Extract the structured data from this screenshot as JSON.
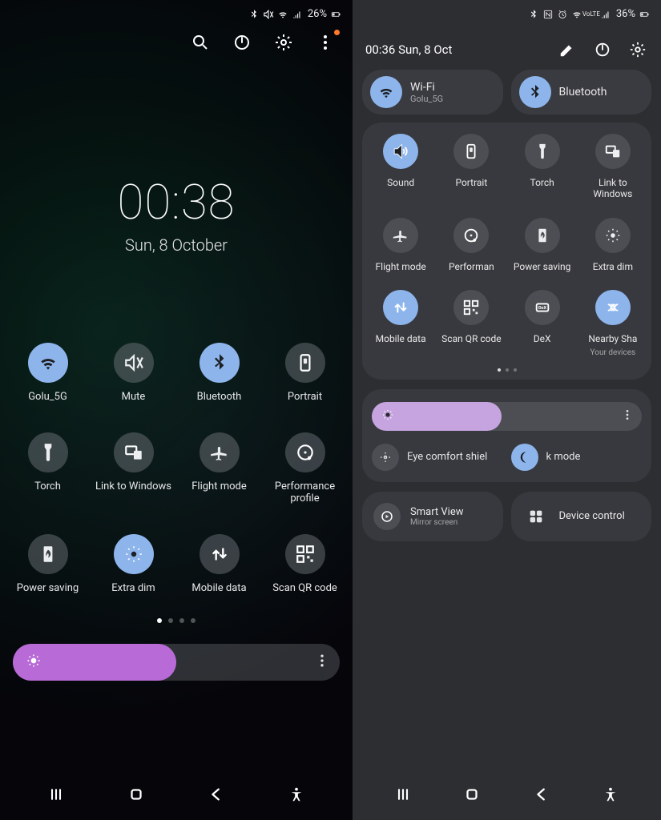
{
  "left": {
    "status": {
      "battery_pct": "26%"
    },
    "clock": {
      "time": "00:38",
      "date": "Sun, 8 October"
    },
    "tiles": [
      {
        "label": "Golu_5G",
        "icon": "wifi",
        "on": true
      },
      {
        "label": "Mute",
        "icon": "mute",
        "on": false
      },
      {
        "label": "Bluetooth",
        "icon": "bluetooth",
        "on": true
      },
      {
        "label": "Portrait",
        "icon": "portrait",
        "on": false
      },
      {
        "label": "Torch",
        "icon": "torch",
        "on": false
      },
      {
        "label": "Link to Windows",
        "icon": "link-windows",
        "on": false
      },
      {
        "label": "Flight mode",
        "icon": "airplane",
        "on": false
      },
      {
        "label": "Performance profile",
        "icon": "performance",
        "on": false
      },
      {
        "label": "Power saving",
        "icon": "power-saving",
        "on": false
      },
      {
        "label": "Extra dim",
        "icon": "extra-dim",
        "on": true
      },
      {
        "label": "Mobile data",
        "icon": "mobile-data",
        "on": false
      },
      {
        "label": "Scan QR code",
        "icon": "qr",
        "on": false
      }
    ],
    "brightness_pct": 50
  },
  "right": {
    "status": {
      "battery_pct": "36%"
    },
    "datetime": "00:36  Sun, 8 Oct",
    "pills": [
      {
        "title": "Wi-Fi",
        "sub": "Golu_5G",
        "icon": "wifi"
      },
      {
        "title": "Bluetooth",
        "sub": "",
        "icon": "bluetooth"
      }
    ],
    "tiles": [
      {
        "label": "Sound",
        "icon": "sound",
        "on": true
      },
      {
        "label": "Portrait",
        "icon": "portrait",
        "on": false
      },
      {
        "label": "Torch",
        "icon": "torch",
        "on": false
      },
      {
        "label": "Link to Windows",
        "icon": "link-windows",
        "on": false
      },
      {
        "label": "Flight mode",
        "icon": "airplane",
        "on": false
      },
      {
        "label": "Performan",
        "icon": "performance",
        "on": false
      },
      {
        "label": "Power saving",
        "icon": "power-saving",
        "on": false
      },
      {
        "label": "Extra dim",
        "icon": "extra-dim",
        "on": false
      },
      {
        "label": "Mobile data",
        "icon": "mobile-data",
        "on": true
      },
      {
        "label": "Scan QR code",
        "icon": "qr",
        "on": false
      },
      {
        "label": "DeX",
        "icon": "dex",
        "on": false
      },
      {
        "label": "Nearby Sha",
        "sublabel": "Your devices",
        "icon": "nearby",
        "on": true
      }
    ],
    "brightness_pct": 48,
    "toggles": [
      {
        "label": "Eye comfort shiel",
        "icon": "eye-comfort",
        "on": false
      },
      {
        "label": "k mode",
        "icon": "dark-mode",
        "on": true
      }
    ],
    "cards": [
      {
        "title": "Smart View",
        "sub": "Mirror screen",
        "icon": "smart-view"
      },
      {
        "title": "Device control",
        "sub": "",
        "icon": "device-control"
      }
    ]
  }
}
